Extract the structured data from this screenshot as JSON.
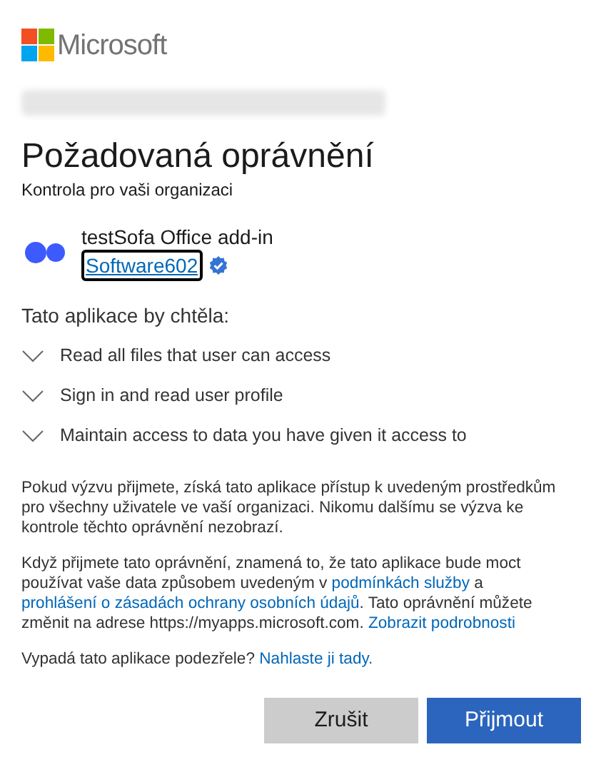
{
  "brand": "Microsoft",
  "title": "Požadovaná oprávnění",
  "subtitle": "Kontrola pro vaši organizaci",
  "app": {
    "name": "testSofa Office add-in",
    "publisher": "Software602",
    "verified": true,
    "publisher_focused": true
  },
  "permissions_heading": "Tato aplikace by chtěla:",
  "permissions": [
    {
      "label": "Read all files that user can access",
      "expanded": false
    },
    {
      "label": "Sign in and read user profile",
      "expanded": false
    },
    {
      "label": "Maintain access to data you have given it access to",
      "expanded": false
    }
  ],
  "paragraphs": [
    [
      {
        "kind": "text",
        "text": "Pokud výzvu přijmete, získá tato aplikace přístup k uvedeným prostředkům pro všechny uživatele ve vaší organizaci. Nikomu dalšímu se výzva ke kontrole těchto oprávnění nezobrazí."
      }
    ],
    [
      {
        "kind": "text",
        "text": "Když přijmete tato oprávnění, znamená to, že tato aplikace bude moct používat vaše data způsobem uvedeným v "
      },
      {
        "kind": "link",
        "text": "podmínkách služby"
      },
      {
        "kind": "text",
        "text": " a "
      },
      {
        "kind": "link",
        "text": "prohlášení o zásadách ochrany osobních údajů"
      },
      {
        "kind": "text",
        "text": ". Tato oprávnění můžete změnit na adrese https://myapps.microsoft.com. "
      },
      {
        "kind": "link",
        "text": "Zobrazit podrobnosti"
      }
    ],
    [
      {
        "kind": "text",
        "text": "Vypadá tato aplikace podezřele? "
      },
      {
        "kind": "link",
        "text": "Nahlaste ji tady."
      }
    ]
  ],
  "buttons": [
    {
      "label": "Zrušit",
      "kind": "secondary"
    },
    {
      "label": "Přijmout",
      "kind": "primary"
    }
  ]
}
